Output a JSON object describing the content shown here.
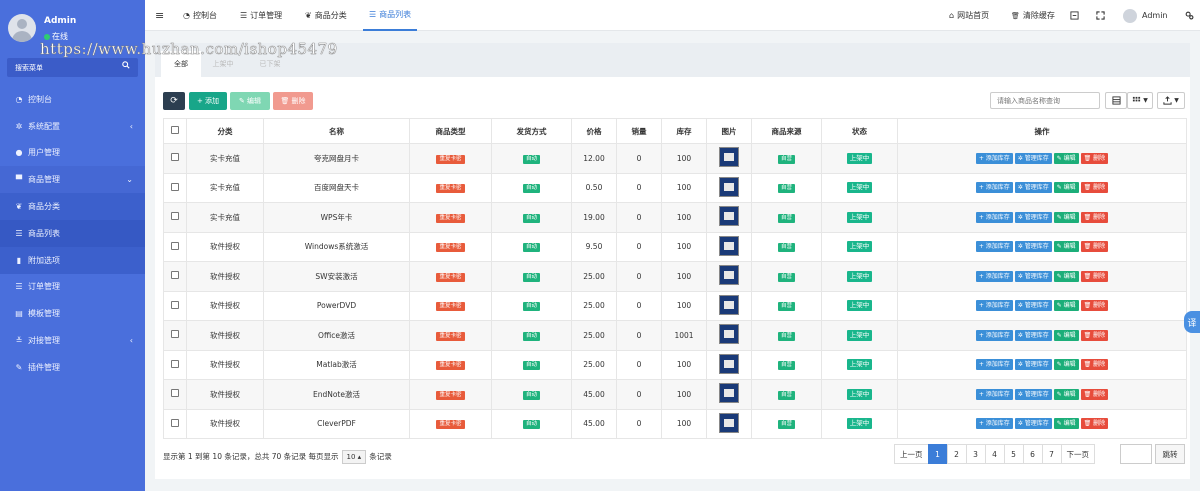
{
  "user": {
    "name": "Admin",
    "status": "在线"
  },
  "watermark": "https://www.huzhan.com/ishop45479",
  "sidebar": {
    "search_label": "搜索菜单",
    "items": [
      {
        "icon": "dashboard-icon",
        "glyph": "◔",
        "label": "控制台"
      },
      {
        "icon": "gear-icon",
        "glyph": "✲",
        "label": "系统配置",
        "arrow": "‹"
      },
      {
        "icon": "user-icon",
        "glyph": "●",
        "label": "用户管理"
      },
      {
        "icon": "cart-icon",
        "glyph": "▀",
        "label": "商品管理",
        "arrow": "⌄"
      },
      {
        "icon": "leaf-icon",
        "glyph": "❦",
        "label": "商品分类"
      },
      {
        "icon": "list-icon",
        "glyph": "☰",
        "label": "商品列表"
      },
      {
        "icon": "bookmark-icon",
        "glyph": "▮",
        "label": "附加选项"
      },
      {
        "icon": "list-icon",
        "glyph": "☰",
        "label": "订单管理"
      },
      {
        "icon": "template-icon",
        "glyph": "▤",
        "label": "模板管理"
      },
      {
        "icon": "sliders-icon",
        "glyph": "≚",
        "label": "对接管理",
        "arrow": "‹"
      },
      {
        "icon": "plugin-icon",
        "glyph": "✎",
        "label": "插件管理"
      }
    ]
  },
  "topbar": {
    "menu_glyph": "≡",
    "tabs": [
      {
        "label": "控制台",
        "glyph": "◔"
      },
      {
        "label": "订单管理",
        "glyph": "☰"
      },
      {
        "label": "商品分类",
        "glyph": "❦"
      },
      {
        "label": "商品列表",
        "glyph": "☰"
      }
    ],
    "right": [
      {
        "label": "网站首页",
        "glyph": "⌂"
      },
      {
        "label": "清除缓存",
        "glyph": "🗑"
      }
    ],
    "admin": "Admin"
  },
  "status_tabs": [
    "全部",
    "上架中",
    "已下架"
  ],
  "toolbar": {
    "refresh": "⟳",
    "add": "+ 添加",
    "edit": "✎ 编辑",
    "delete": "🗑 删除",
    "search_placeholder": "请输入商品名称查询"
  },
  "table": {
    "headers": [
      "分类",
      "名称",
      "商品类型",
      "发货方式",
      "价格",
      "销量",
      "库存",
      "图片",
      "商品来源",
      "状态",
      "操作"
    ],
    "rows": [
      {
        "cat": "实卡充值",
        "name": "夸克网盘月卡",
        "type": "重复卡密",
        "ship": "自动",
        "price": "12.00",
        "sales": "0",
        "stock": "100",
        "src": "自营",
        "status": "上架中"
      },
      {
        "cat": "实卡充值",
        "name": "百度网盘天卡",
        "type": "重复卡密",
        "ship": "自动",
        "price": "0.50",
        "sales": "0",
        "stock": "100",
        "src": "自营",
        "status": "上架中"
      },
      {
        "cat": "实卡充值",
        "name": "WPS年卡",
        "type": "重复卡密",
        "ship": "自动",
        "price": "19.00",
        "sales": "0",
        "stock": "100",
        "src": "自营",
        "status": "上架中"
      },
      {
        "cat": "软件授权",
        "name": "Windows系统激活",
        "type": "重复卡密",
        "ship": "自动",
        "price": "9.50",
        "sales": "0",
        "stock": "100",
        "src": "自营",
        "status": "上架中"
      },
      {
        "cat": "软件授权",
        "name": "SW安装激活",
        "type": "重复卡密",
        "ship": "自动",
        "price": "25.00",
        "sales": "0",
        "stock": "100",
        "src": "自营",
        "status": "上架中"
      },
      {
        "cat": "软件授权",
        "name": "PowerDVD",
        "type": "重复卡密",
        "ship": "自动",
        "price": "25.00",
        "sales": "0",
        "stock": "100",
        "src": "自营",
        "status": "上架中"
      },
      {
        "cat": "软件授权",
        "name": "Office激活",
        "type": "重复卡密",
        "ship": "自动",
        "price": "25.00",
        "sales": "0",
        "stock": "1001",
        "src": "自营",
        "status": "上架中"
      },
      {
        "cat": "软件授权",
        "name": "Matlab激活",
        "type": "重复卡密",
        "ship": "自动",
        "price": "25.00",
        "sales": "0",
        "stock": "100",
        "src": "自营",
        "status": "上架中"
      },
      {
        "cat": "软件授权",
        "name": "EndNote激活",
        "type": "重复卡密",
        "ship": "自动",
        "price": "45.00",
        "sales": "0",
        "stock": "100",
        "src": "自营",
        "status": "上架中"
      },
      {
        "cat": "软件授权",
        "name": "CleverPDF",
        "type": "重复卡密",
        "ship": "自动",
        "price": "45.00",
        "sales": "0",
        "stock": "100",
        "src": "自营",
        "status": "上架中"
      }
    ],
    "actions": [
      "+ 添加库存",
      "✲ 管理库存",
      "✎ 编辑",
      "🗑 删除"
    ]
  },
  "footer": {
    "info_prefix": "显示第 1 到第 10 条记录，总共 70 条记录 每页显示",
    "page_size": "10 ▴",
    "info_suffix": "条记录"
  },
  "pagination": {
    "prev": "上一页",
    "pages": [
      "1",
      "2",
      "3",
      "4",
      "5",
      "6",
      "7"
    ],
    "next": "下一页",
    "jump": "跳转"
  },
  "translate_label": "译"
}
